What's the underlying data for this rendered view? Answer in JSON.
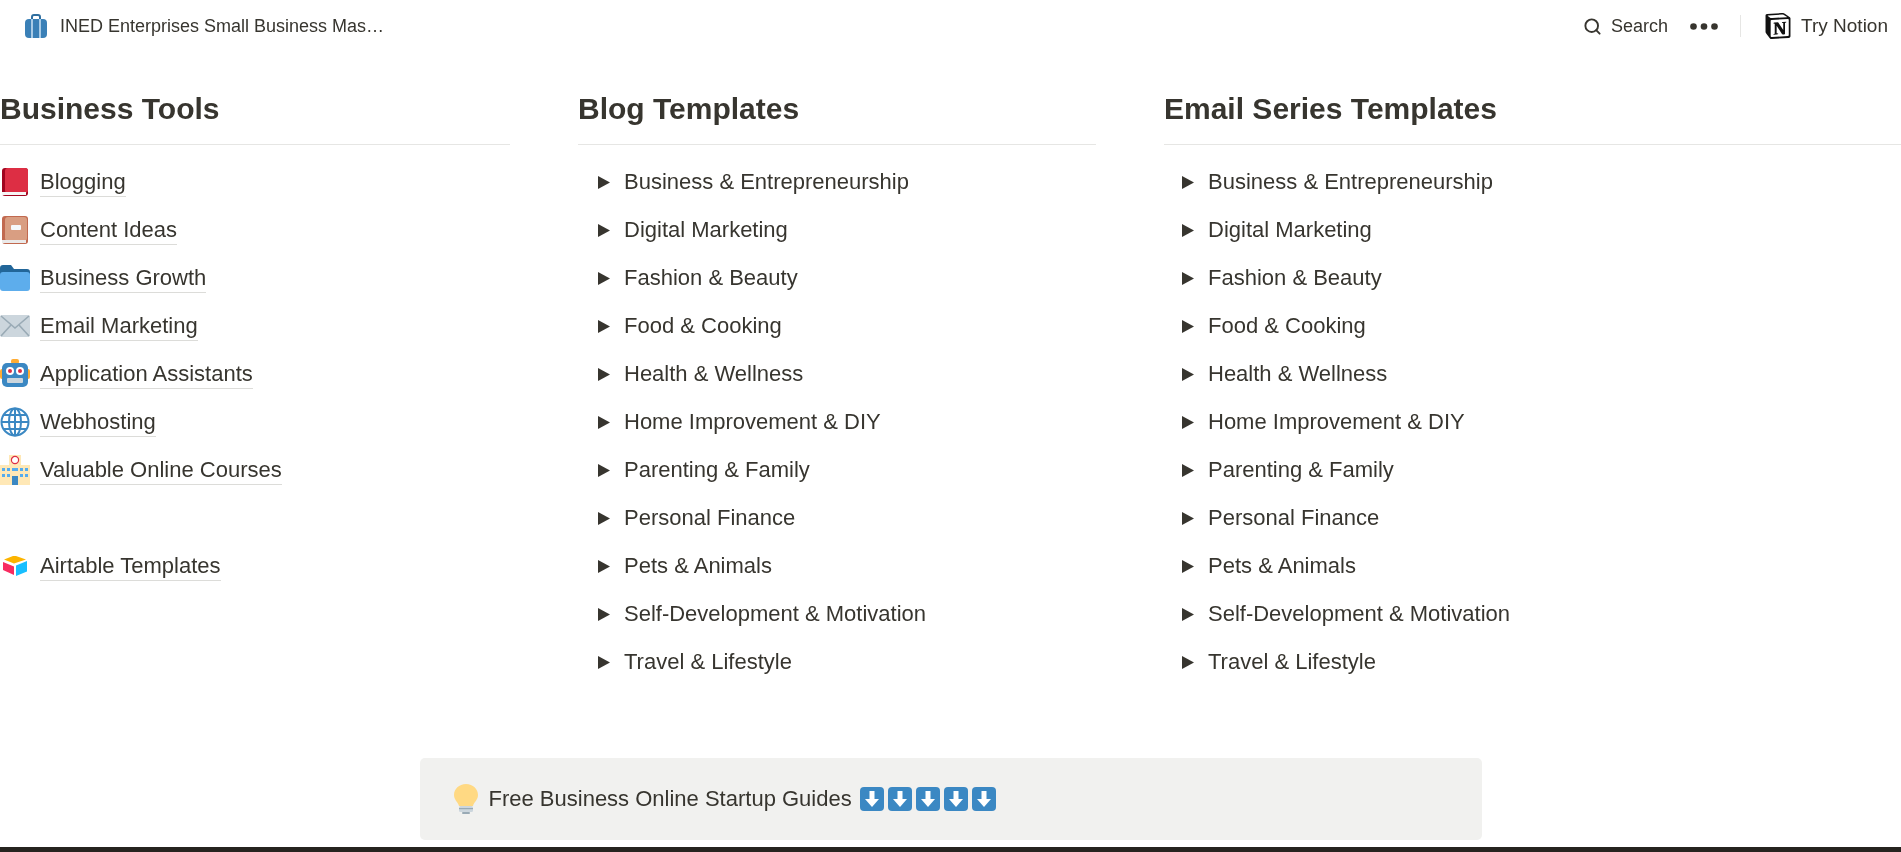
{
  "topbar": {
    "title": "INED Enterprises Small Business Mas…",
    "search": {
      "label": "Search"
    },
    "try_notion": {
      "label": "Try Notion"
    }
  },
  "columns": [
    {
      "kind": "links",
      "heading": "Business Tools",
      "groups": [
        {
          "items": [
            {
              "label": "Blogging"
            },
            {
              "label": "Content Ideas"
            },
            {
              "label": "Business Growth"
            },
            {
              "label": "Email Marketing"
            },
            {
              "label": "Application Assistants"
            },
            {
              "label": "Webhosting"
            },
            {
              "label": "Valuable Online Courses"
            }
          ]
        },
        {
          "items": [
            {
              "label": "Airtable Templates"
            }
          ]
        }
      ]
    },
    {
      "kind": "toggles",
      "heading": "Blog Templates",
      "items": [
        {
          "label": "Business & Entrepreneurship",
          "expanded": false
        },
        {
          "label": "Digital Marketing",
          "expanded": false
        },
        {
          "label": "Fashion & Beauty",
          "expanded": false
        },
        {
          "label": "Food & Cooking",
          "expanded": false
        },
        {
          "label": "Health & Wellness",
          "expanded": false
        },
        {
          "label": "Home Improvement & DIY",
          "expanded": false
        },
        {
          "label": "Parenting & Family",
          "expanded": false
        },
        {
          "label": "Personal Finance",
          "expanded": false
        },
        {
          "label": "Pets & Animals",
          "expanded": false
        },
        {
          "label": "Self-Development & Motivation",
          "expanded": false
        },
        {
          "label": "Travel & Lifestyle",
          "expanded": false
        }
      ]
    },
    {
      "kind": "toggles",
      "heading": "Email Series Templates",
      "items": [
        {
          "label": "Business & Entrepreneurship",
          "expanded": false
        },
        {
          "label": "Digital Marketing",
          "expanded": false
        },
        {
          "label": "Fashion & Beauty",
          "expanded": false
        },
        {
          "label": "Food & Cooking",
          "expanded": false
        },
        {
          "label": "Health & Wellness",
          "expanded": false
        },
        {
          "label": "Home Improvement & DIY",
          "expanded": false
        },
        {
          "label": "Parenting & Family",
          "expanded": false
        },
        {
          "label": "Personal Finance",
          "expanded": false
        },
        {
          "label": "Pets & Animals",
          "expanded": false
        },
        {
          "label": "Self-Development & Motivation",
          "expanded": false
        },
        {
          "label": "Travel & Lifestyle",
          "expanded": false
        }
      ]
    }
  ],
  "callout": {
    "text": "Free Business Online Startup Guides",
    "trailing_icons": [
      {
        "kind": "down-arrow"
      },
      {
        "kind": "down-arrow"
      },
      {
        "kind": "down-arrow"
      },
      {
        "kind": "down-arrow"
      },
      {
        "kind": "down-arrow"
      }
    ]
  }
}
